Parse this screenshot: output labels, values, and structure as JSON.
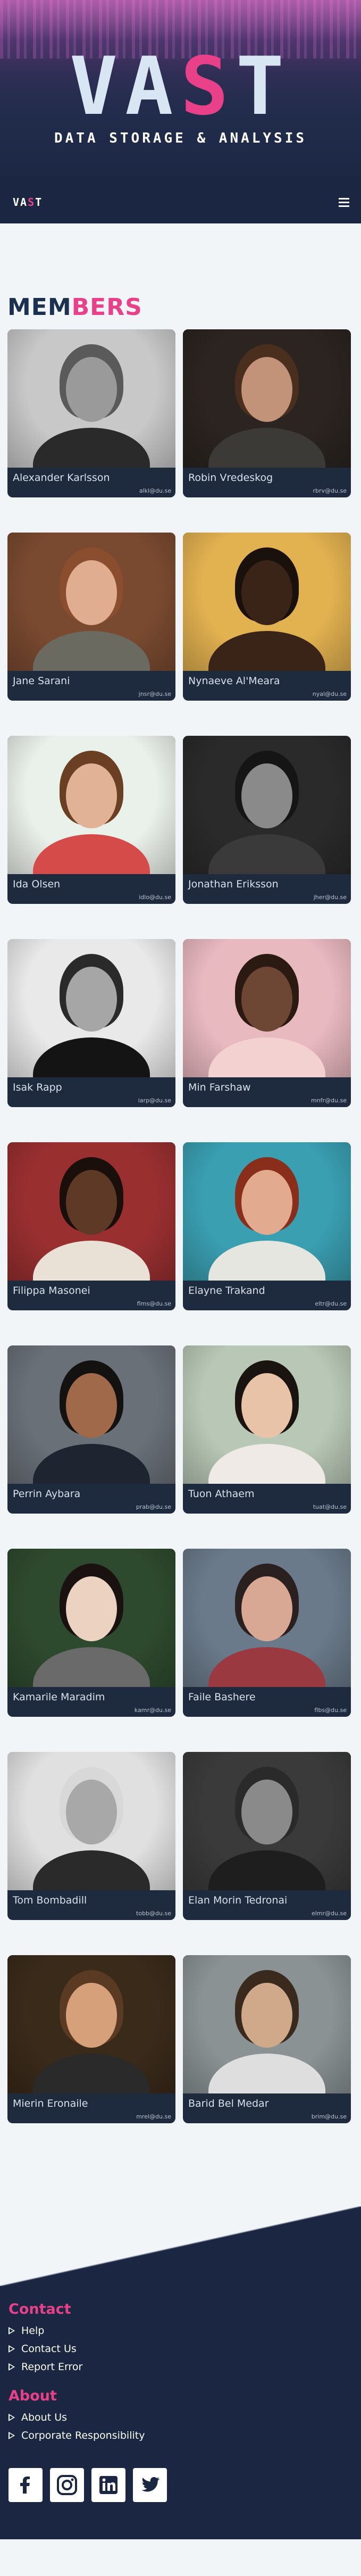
{
  "hero": {
    "logo_left": "VA",
    "logo_accent": "S",
    "logo_right": "T",
    "tagline": "DATA STORAGE & ANALYSIS"
  },
  "nav": {
    "brand_left": "VA",
    "brand_accent": "S",
    "brand_right": "T",
    "menu_icon": "hamburger-icon"
  },
  "members": {
    "heading_part1": "MEM",
    "heading_part2": "BERS",
    "list": [
      {
        "name": "Alexander Karlsson",
        "email": "alkl@du.se",
        "photo": {
          "bg": "#c8c8c8",
          "skin": "#9a9a9a",
          "hair": "#5a5a5a",
          "shirt": "#2a2a2a"
        }
      },
      {
        "name": "Robin Vredeskog",
        "email": "rbrv@du.se",
        "photo": {
          "bg": "#2b2420",
          "skin": "#c39379",
          "hair": "#4a2e1e",
          "shirt": "#3b3a36"
        }
      },
      {
        "name": "Jane Sarani",
        "email": "jnsr@du.se",
        "photo": {
          "bg": "#7a4a30",
          "skin": "#e0ad90",
          "hair": "#8a4d2e",
          "shirt": "#6a6a60"
        }
      },
      {
        "name": "Nynaeve Al'Meara",
        "email": "nyal@du.se",
        "photo": {
          "bg": "#e2b150",
          "skin": "#3a2418",
          "hair": "#1a100c",
          "shirt": "#3a2418"
        }
      },
      {
        "name": "Ida Olsen",
        "email": "idlo@du.se",
        "photo": {
          "bg": "#eaf0ea",
          "skin": "#e2b297",
          "hair": "#6a3f24",
          "shirt": "#d44b4a"
        }
      },
      {
        "name": "Jonathan Eriksson",
        "email": "jher@du.se",
        "photo": {
          "bg": "#2a2a2a",
          "skin": "#8a8a8a",
          "hair": "#151515",
          "shirt": "#3a3a3a"
        }
      },
      {
        "name": "Isak Rapp",
        "email": "iarp@du.se",
        "photo": {
          "bg": "#e9e9e9",
          "skin": "#a6a6a6",
          "hair": "#2a2a2a",
          "shirt": "#141414"
        }
      },
      {
        "name": "Min Farshaw",
        "email": "mnfr@du.se",
        "photo": {
          "bg": "#e9b9c0",
          "skin": "#6e4634",
          "hair": "#2a1a12",
          "shirt": "#f3d1d0"
        }
      },
      {
        "name": "Filippa Masonei",
        "email": "flms@du.se",
        "photo": {
          "bg": "#9a2f30",
          "skin": "#5e3a26",
          "hair": "#1a0f0a",
          "shirt": "#e9e1d6"
        }
      },
      {
        "name": "Elayne Trakand",
        "email": "eltr@du.se",
        "photo": {
          "bg": "#3a9fb1",
          "skin": "#e2ab90",
          "hair": "#8a2e1c",
          "shirt": "#e6e6e0"
        }
      },
      {
        "name": "Perrin Aybara",
        "email": "prab@du.se",
        "photo": {
          "bg": "#6a7078",
          "skin": "#a06a4a",
          "hair": "#141210",
          "shirt": "#1e2430"
        }
      },
      {
        "name": "Tuon Athaem",
        "email": "tuat@du.se",
        "photo": {
          "bg": "#b9c8b6",
          "skin": "#e8c3a8",
          "hair": "#1a1410",
          "shirt": "#efeae6"
        }
      },
      {
        "name": "Kamarile Maradim",
        "email": "kamr@du.se",
        "photo": {
          "bg": "#2e4a2e",
          "skin": "#ecd2c0",
          "hair": "#1a1210",
          "shirt": "#6a6a6a"
        }
      },
      {
        "name": "Faile Bashere",
        "email": "flbs@du.se",
        "photo": {
          "bg": "#6a7a8a",
          "skin": "#d8a894",
          "hair": "#2a2020",
          "shirt": "#9a3a40"
        }
      },
      {
        "name": "Tom Bombadill",
        "email": "tobb@du.se",
        "photo": {
          "bg": "#e0e0e0",
          "skin": "#a8a8a8",
          "hair": "#d8d8d8",
          "shirt": "#2a2a2a"
        }
      },
      {
        "name": "Elan Morin Tedronai",
        "email": "elmr@du.se",
        "photo": {
          "bg": "#3a3a3a",
          "skin": "#8a8a8a",
          "hair": "#2a2a2a",
          "shirt": "#1e1e1e"
        }
      },
      {
        "name": "Mierin Eronaile",
        "email": "mrel@du.se",
        "photo": {
          "bg": "#3a2a1a",
          "skin": "#d6a07a",
          "hair": "#5a3a22",
          "shirt": "#2a2a2a"
        }
      },
      {
        "name": "Barid Bel Medar",
        "email": "brim@du.se",
        "photo": {
          "bg": "#8a9294",
          "skin": "#d0a88a",
          "hair": "#3a2a1e",
          "shirt": "#dedede"
        }
      }
    ]
  },
  "footer": {
    "contact_heading": "Contact",
    "contact_links": [
      "Help",
      "Contact Us",
      "Report Error"
    ],
    "about_heading": "About",
    "about_links": [
      "About Us",
      "Corporate Responsibility"
    ],
    "social": [
      {
        "icon": "facebook-icon",
        "label": "f"
      },
      {
        "icon": "instagram-icon",
        "label": ""
      },
      {
        "icon": "linkedin-icon",
        "label": "in"
      },
      {
        "icon": "twitter-icon",
        "label": ""
      }
    ]
  }
}
